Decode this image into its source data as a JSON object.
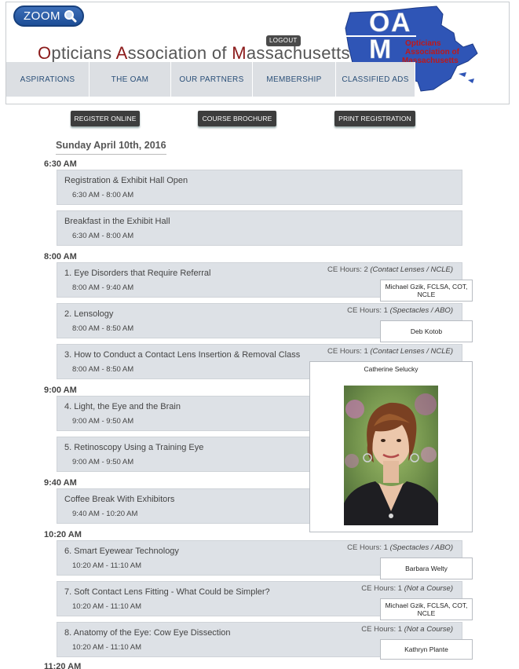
{
  "header": {
    "zoom_label": "ZOOM",
    "logout_label": "LOGOUT",
    "site_title": {
      "w1c": "O",
      "w1": "pticians ",
      "w2c": "A",
      "w2": "ssociation of ",
      "w3c": "M",
      "w3": "assachusetts"
    },
    "logo": {
      "letters": "OAM",
      "text_line1": "Opticians",
      "text_line2": "Association of",
      "text_line3": "Massachusetts"
    },
    "nav": [
      "ASPIRATIONS",
      "THE OAM",
      "OUR PARTNERS",
      "MEMBERSHIP",
      "CLASSIFIED ADS"
    ]
  },
  "actions": {
    "register": "REGISTER ONLINE",
    "brochure": "COURSE BROCHURE",
    "print": "PRINT REGISTRATION"
  },
  "schedule": {
    "date": "Sunday April 10th, 2016",
    "time_labels": [
      "6:30 AM",
      "8:00 AM",
      "9:00 AM",
      "9:40 AM",
      "10:20 AM",
      "11:20 AM"
    ],
    "sessions": [
      {
        "title": "Registration & Exhibit Hall Open",
        "time": "6:30 AM - 8:00 AM"
      },
      {
        "title": "Breakfast in the Exhibit Hall",
        "time": "6:30 AM - 8:00 AM"
      },
      {
        "title": "1. Eye Disorders that Require Referral",
        "time": "8:00 AM - 9:40 AM",
        "ce_prefix": "CE Hours: 2",
        "ce_type": "(Contact Lenses / NCLE)",
        "speaker": "Michael Gzik, FCLSA, COT, NCLE"
      },
      {
        "title": "2. Lensology",
        "time": "8:00 AM - 8:50 AM",
        "ce_prefix": "CE Hours: 1",
        "ce_type": "(Spectacles / ABO)",
        "speaker": "Deb Kotob"
      },
      {
        "title": "3. How to Conduct a Contact Lens Insertion & Removal Class",
        "time": "8:00 AM - 8:50 AM",
        "ce_prefix": "CE Hours: 1",
        "ce_type": "(Contact Lenses / NCLE)"
      },
      {
        "title": "4. Light, the Eye and the Brain",
        "time": "9:00 AM - 9:50 AM"
      },
      {
        "title": "5. Retinoscopy Using a Training Eye",
        "time": "9:00 AM - 9:50 AM"
      },
      {
        "title": "Coffee Break With Exhibitors",
        "time": "9:40 AM - 10:20 AM"
      },
      {
        "title": "6. Smart Eyewear Technology",
        "time": "10:20 AM - 11:10 AM",
        "ce_prefix": "CE Hours: 1",
        "ce_type": "(Spectacles / ABO)",
        "speaker": "Barbara Welty"
      },
      {
        "title": "7. Soft Contact Lens Fitting - What Could be Simpler?",
        "time": "10:20 AM - 11:10 AM",
        "ce_prefix": "CE Hours: 1",
        "ce_type": "(Not a Course)",
        "speaker": "Michael Gzik, FCLSA, COT, NCLE"
      },
      {
        "title": "8. Anatomy of the Eye: Cow Eye Dissection",
        "time": "10:20 AM - 11:10 AM",
        "ce_prefix": "CE Hours: 1",
        "ce_type": "(Not a Course)",
        "speaker": "Kathryn Plante"
      }
    ],
    "popup_speaker": "Catherine Selucky"
  },
  "colors": {
    "accent": "#1d4e97",
    "title_capital": "#8b1a1a",
    "nav_bg": "#dcdfe3",
    "session_bg": "#dde1e6"
  }
}
